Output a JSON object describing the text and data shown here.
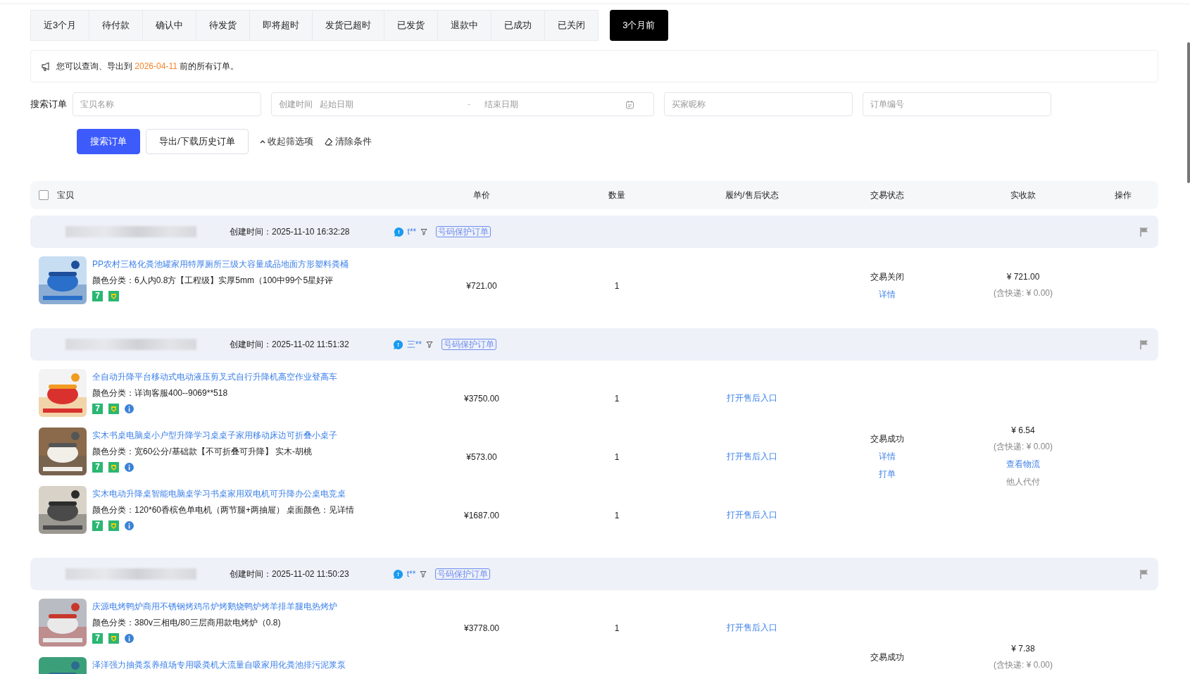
{
  "tabs": [
    {
      "label": "近3个月",
      "selected": false
    },
    {
      "label": "待付款",
      "selected": false
    },
    {
      "label": "确认中",
      "selected": false
    },
    {
      "label": "待发货",
      "selected": false
    },
    {
      "label": "即将超时",
      "selected": false
    },
    {
      "label": "发货已超时",
      "selected": false
    },
    {
      "label": "已发货",
      "selected": false
    },
    {
      "label": "退款中",
      "selected": false
    },
    {
      "label": "已成功",
      "selected": false
    },
    {
      "label": "已关闭",
      "selected": false
    },
    {
      "label": "3个月前",
      "selected": true
    }
  ],
  "notice": {
    "before": "您可以查询、导出到 ",
    "date": "2026-04-11",
    "after": " 前的所有订单。"
  },
  "search": {
    "label": "搜索订单",
    "item_name": {
      "placeholder": "宝贝名称"
    },
    "created": {
      "label": "创建时间",
      "start": {
        "placeholder": "起始日期"
      },
      "separator": "-",
      "end": {
        "placeholder": "结束日期"
      }
    },
    "buyer": {
      "placeholder": "买家昵称"
    },
    "order_no": {
      "placeholder": "订单编号"
    }
  },
  "actions": {
    "search_button": "搜索订单",
    "export_button": "导出/下载历史订单",
    "collapse_link": "收起筛选项",
    "clear_link": "清除条件"
  },
  "table": {
    "select_all": {
      "checked": false
    },
    "columns": [
      "宝贝",
      "单价",
      "数量",
      "履约/售后状态",
      "交易状态",
      "实收款",
      "操作"
    ]
  },
  "orders": [
    {
      "created": "创建时间：2025-11-10 16:32:28",
      "buyer": "t**",
      "tag": "号码保护订单",
      "items": [
        {
          "title": "PP农村三格化粪池罐家用特厚厕所三级大容量成品地面方形塑料粪桶",
          "sku": "颜色分类：6人内0.8方【工程级】实厚5mm（100中99个5星好评",
          "badges": [
            {
              "kind": "seven",
              "text": "7"
            },
            {
              "kind": "guarantee"
            }
          ],
          "price": "¥721.00",
          "qty": "1"
        }
      ],
      "status": [
        {
          "kind": "text",
          "text": "交易关闭"
        },
        {
          "kind": "link",
          "text": "详情"
        }
      ],
      "amount": [
        {
          "kind": "text",
          "text": "¥ 721.00"
        },
        {
          "kind": "note",
          "text": "(含快递: ¥ 0.00)"
        }
      ]
    },
    {
      "created": "创建时间：2025-11-02 11:51:32",
      "buyer": "三**",
      "tag": "号码保护订单",
      "items": [
        {
          "title": "全自动升降平台移动式电动液压剪叉式自行升降机高空作业登高车",
          "sku": "颜色分类：详询客服400--9069**518",
          "badges": [
            {
              "kind": "seven",
              "text": "7"
            },
            {
              "kind": "guarantee"
            },
            {
              "kind": "info"
            }
          ],
          "price": "¥3750.00",
          "qty": "1",
          "aftersale": "打开售后入口"
        },
        {
          "title": "实木书桌电脑桌小户型升降学习桌桌子家用移动床边可折叠小桌子",
          "sku": "颜色分类：宽60公分/基础款【不可折叠可升降】 实木-胡桃",
          "badges": [
            {
              "kind": "seven",
              "text": "7"
            },
            {
              "kind": "guarantee"
            },
            {
              "kind": "info"
            }
          ],
          "price": "¥573.00",
          "qty": "1",
          "aftersale": "打开售后入口"
        },
        {
          "title": "实木电动升降桌智能电脑桌学习书桌家用双电机可升降办公桌电竞桌",
          "sku": "颜色分类：120*60香槟色单电机（两节腿+两抽屉） 桌面颜色：见详情",
          "badges": [
            {
              "kind": "seven",
              "text": "7"
            },
            {
              "kind": "guarantee"
            },
            {
              "kind": "info"
            }
          ],
          "price": "¥1687.00",
          "qty": "1",
          "aftersale": "打开售后入口"
        }
      ],
      "status": [
        {
          "kind": "text",
          "text": "交易成功"
        },
        {
          "kind": "link",
          "text": "详情"
        },
        {
          "kind": "link",
          "text": "打单"
        }
      ],
      "amount": [
        {
          "kind": "text",
          "text": "¥ 6.54"
        },
        {
          "kind": "note",
          "text": "(含快递: ¥ 0.00)"
        },
        {
          "kind": "link",
          "text": "查看物流"
        },
        {
          "kind": "note",
          "text": "他人代付"
        }
      ]
    },
    {
      "created": "创建时间：2025-11-02 11:50:23",
      "buyer": "t**",
      "tag": "号码保护订单",
      "items": [
        {
          "title": "庆源电烤鸭炉商用不锈钢烤鸡吊炉烤鹅烧鸭炉烤羊排羊腿电热烤炉",
          "sku": "颜色分类：380v三相电/80三层商用款电烤炉（0.8)",
          "badges": [
            {
              "kind": "seven",
              "text": "7"
            },
            {
              "kind": "guarantee"
            },
            {
              "kind": "info"
            }
          ],
          "price": "¥3778.00",
          "qty": "1",
          "aftersale": "打开售后入口"
        },
        {
          "title": "泽洋强力抽粪泵养殖场专用吸粪机大流量自吸家用化粪池排污泥浆泵"
        }
      ],
      "status": [
        {
          "kind": "text",
          "text": "交易成功"
        }
      ],
      "amount": [
        {
          "kind": "text",
          "text": "¥ 7.38"
        },
        {
          "kind": "note",
          "text": "(含快递: ¥ 0.00)"
        }
      ]
    }
  ]
}
